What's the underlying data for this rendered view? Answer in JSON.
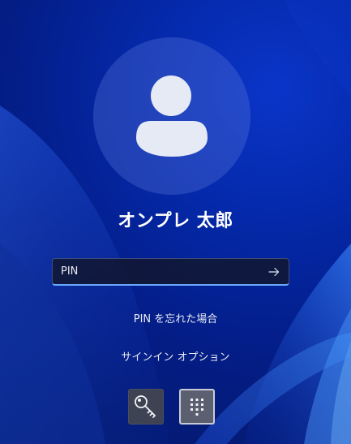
{
  "screen": {
    "user_name": "オンプレ 太郎"
  },
  "pin": {
    "placeholder": "PIN",
    "value": "",
    "submit_icon": "arrow-right-icon"
  },
  "links": {
    "forgot_pin": "PIN を忘れた場合",
    "sign_in_options": "サインイン オプション"
  },
  "sign_in_methods": [
    {
      "icon": "key-icon",
      "selected": false
    },
    {
      "icon": "pin-keypad-icon",
      "selected": true
    }
  ],
  "colors": {
    "accent": "#6aa8ff",
    "background": "#0428a8"
  }
}
